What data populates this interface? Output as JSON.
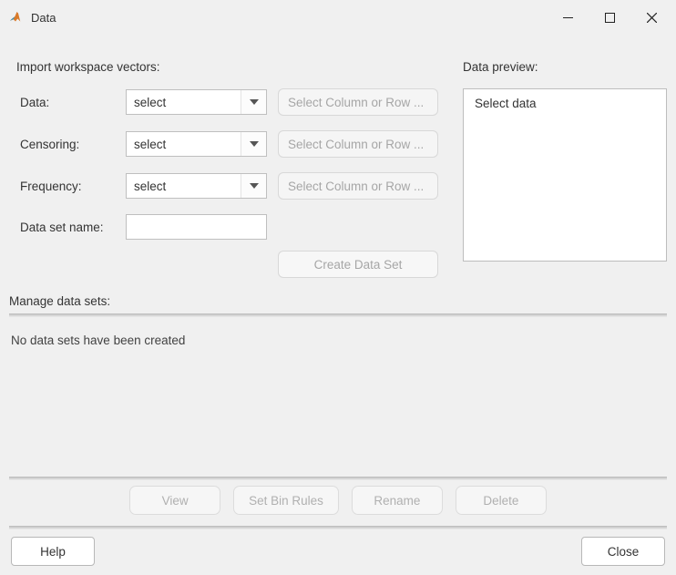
{
  "window": {
    "title": "Data"
  },
  "import": {
    "heading": "Import workspace vectors:",
    "data_label": "Data:",
    "censoring_label": "Censoring:",
    "frequency_label": "Frequency:",
    "dataset_name_label": "Data set name:",
    "select_placeholder": "select",
    "colrow_label": "Select Column or Row ...",
    "dataset_name_value": "",
    "create_button": "Create Data Set"
  },
  "preview": {
    "heading": "Data preview:",
    "body": "Select data"
  },
  "manage": {
    "heading": "Manage data sets:",
    "empty_text": "No data sets have been created"
  },
  "buttons": {
    "view": "View",
    "set_bin_rules": "Set Bin Rules",
    "rename": "Rename",
    "delete": "Delete",
    "help": "Help",
    "close": "Close"
  }
}
